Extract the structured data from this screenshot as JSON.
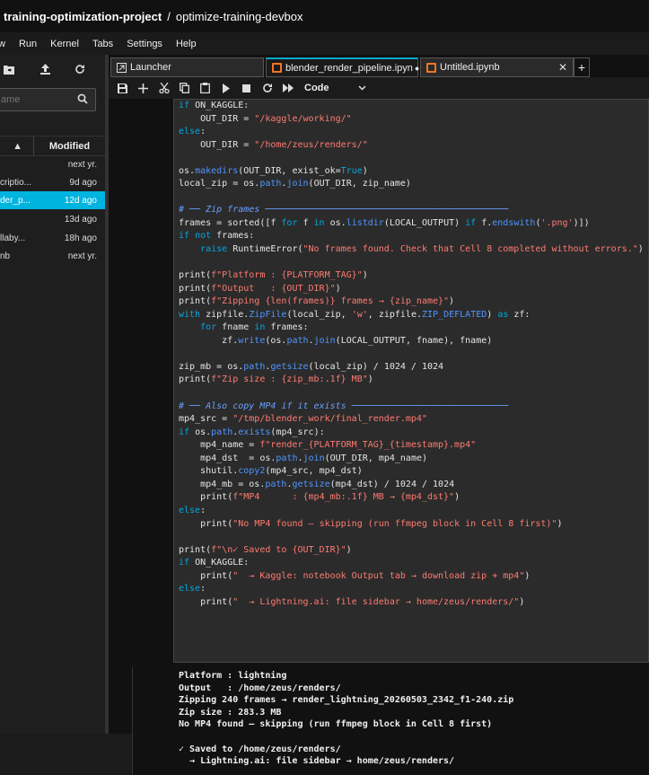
{
  "title": {
    "project": "training-optimization-project",
    "separator": "/",
    "studio": "optimize-training-devbox"
  },
  "menu": [
    "w",
    "Run",
    "Kernel",
    "Tabs",
    "Settings",
    "Help"
  ],
  "sidebar": {
    "search_placeholder": "ame",
    "columns": {
      "name": "▲",
      "modified": "Modified"
    },
    "files": [
      {
        "name": "",
        "modified": "next yr.",
        "selected": false
      },
      {
        "name": "criptio...",
        "modified": "9d ago",
        "selected": false
      },
      {
        "name": "der_p...",
        "modified": "12d ago",
        "selected": true
      },
      {
        "name": "",
        "modified": "13d ago",
        "selected": false
      },
      {
        "name": "llaby...",
        "modified": "18h ago",
        "selected": false
      },
      {
        "name": "nb",
        "modified": "next yr.",
        "selected": false
      }
    ]
  },
  "tabs": [
    {
      "label": "Launcher"
    },
    {
      "label": "blender_render_pipeline.ipyn",
      "modified_dot": "●"
    },
    {
      "label": "Untitled.ipynb",
      "close": "✕"
    }
  ],
  "new_tab": "+",
  "toolbar": {
    "cell_type": "Code"
  },
  "code_lines": [
    "if ON_KAGGLE:",
    "    OUT_DIR = \"/kaggle/working/\"",
    "else:",
    "    OUT_DIR = \"/home/zeus/renders/\"",
    "",
    "os.makedirs(OUT_DIR, exist_ok=True)",
    "local_zip = os.path.join(OUT_DIR, zip_name)",
    "",
    "# ── Zip frames ─────────────────────────────────────────────",
    "frames = sorted([f for f in os.listdir(LOCAL_OUTPUT) if f.endswith('.png')])",
    "if not frames:",
    "    raise RuntimeError(\"No frames found. Check that Cell 8 completed without errors.\")",
    "",
    "print(f\"Platform : {PLATFORM_TAG}\")",
    "print(f\"Output   : {OUT_DIR}\")",
    "print(f\"Zipping {len(frames)} frames → {zip_name}\")",
    "with zipfile.ZipFile(local_zip, 'w', zipfile.ZIP_DEFLATED) as zf:",
    "    for fname in frames:",
    "        zf.write(os.path.join(LOCAL_OUTPUT, fname), fname)",
    "",
    "zip_mb = os.path.getsize(local_zip) / 1024 / 1024",
    "print(f\"Zip size : {zip_mb:.1f} MB\")",
    "",
    "# ── Also copy MP4 if it exists ─────────────────────────────",
    "mp4_src = \"/tmp/blender_work/final_render.mp4\"",
    "if os.path.exists(mp4_src):",
    "    mp4_name = f\"render_{PLATFORM_TAG}_{timestamp}.mp4\"",
    "    mp4_dst  = os.path.join(OUT_DIR, mp4_name)",
    "    shutil.copy2(mp4_src, mp4_dst)",
    "    mp4_mb = os.path.getsize(mp4_dst) / 1024 / 1024",
    "    print(f\"MP4      : {mp4_mb:.1f} MB → {mp4_dst}\")",
    "else:",
    "    print(\"No MP4 found — skipping (run ffmpeg block in Cell 8 first)\")",
    "",
    "print(f\"\\n✓ Saved to {OUT_DIR}\")",
    "if ON_KAGGLE:",
    "    print(\"  → Kaggle: notebook Output tab → download zip + mp4\")",
    "else:",
    "    print(\"  → Lightning.ai: file sidebar → home/zeus/renders/\")"
  ],
  "output_lines": [
    "Platform : lightning",
    "Output   : /home/zeus/renders/",
    "Zipping 240 frames → render_lightning_20260503_2342_f1-240.zip",
    "Zip size : 283.3 MB",
    "No MP4 found — skipping (run ffmpeg block in Cell 8 first)",
    "",
    "✓ Saved to /home/zeus/renders/",
    "  → Lightning.ai: file sidebar → home/zeus/renders/"
  ],
  "colors": {
    "accent": "#00b4e0",
    "orange_icon": "#f37626",
    "keyword": "#00a8e0",
    "string": "#ff7b72",
    "comment": "#6aa0ff"
  },
  "icons": [
    "folder-icon",
    "upload-icon",
    "refresh-icon",
    "search-icon",
    "save-icon",
    "add-cell-icon",
    "cut-icon",
    "copy-icon",
    "paste-icon",
    "run-icon",
    "stop-icon",
    "restart-icon",
    "fast-forward-icon",
    "chevron-down-icon"
  ]
}
